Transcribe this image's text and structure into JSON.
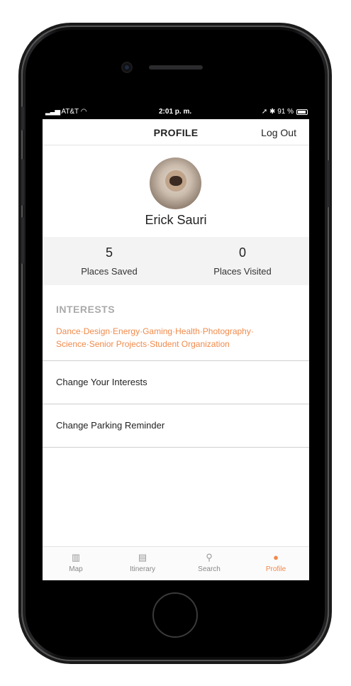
{
  "status_bar": {
    "carrier": "AT&T",
    "time": "2:01 p. m.",
    "battery": "91 %"
  },
  "nav": {
    "title": "PROFILE",
    "logout_label": "Log Out"
  },
  "profile": {
    "name": "Erick Sauri"
  },
  "stats": [
    {
      "value": "5",
      "label": "Places Saved"
    },
    {
      "value": "0",
      "label": "Places Visited"
    }
  ],
  "interests": {
    "title": "INTERESTS",
    "items": [
      "Dance",
      "Design",
      "Energy",
      "Gaming",
      "Health",
      "Photography",
      "Science",
      "Senior Projects",
      "Student Organization"
    ]
  },
  "menu": [
    {
      "label": "Change Your Interests"
    },
    {
      "label": "Change Parking Reminder"
    }
  ],
  "tabs": [
    {
      "label": "Map",
      "icon": "map-icon",
      "active": false
    },
    {
      "label": "Itinerary",
      "icon": "clipboard-icon",
      "active": false
    },
    {
      "label": "Search",
      "icon": "search-icon",
      "active": false
    },
    {
      "label": "Profile",
      "icon": "person-icon",
      "active": true
    }
  ],
  "colors": {
    "accent": "#f08a4b",
    "section_title": "#aaaaaa",
    "stats_bg": "#f3f3f3"
  }
}
